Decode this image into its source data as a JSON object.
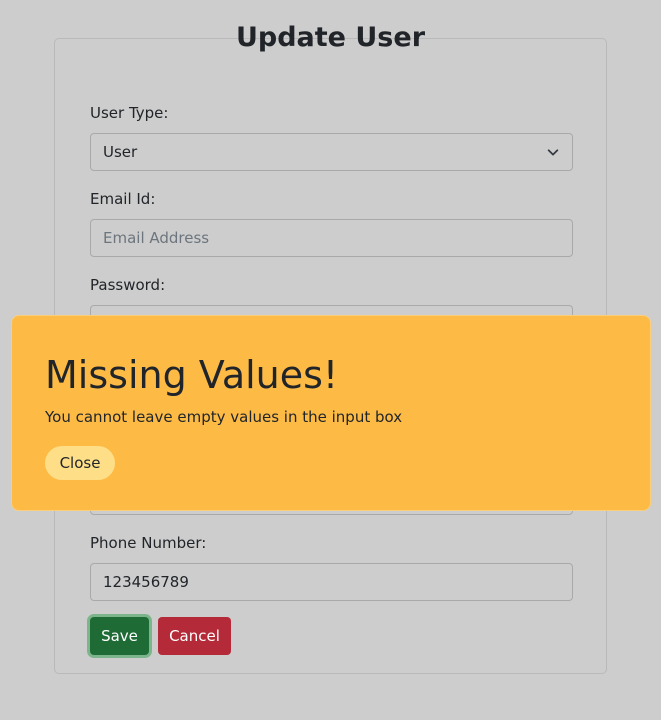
{
  "form": {
    "title": "Update User",
    "user_type_label": "User Type:",
    "user_type_value": "User",
    "email_label": "Email Id:",
    "email_placeholder": "Email Address",
    "email_value": "",
    "password_label": "Password:",
    "phone_label": "Phone Number:",
    "phone_value": "123456789",
    "save_label": "Save",
    "cancel_label": "Cancel"
  },
  "alert": {
    "title": "Missing Values!",
    "message": "You cannot leave empty values in the input box",
    "close_label": "Close"
  },
  "colors": {
    "background": "#cdcdcd",
    "alert": "#fdbb46",
    "save": "#1f6b36",
    "cancel": "#b52a38"
  },
  "icons": {
    "select_arrow": "chevron-down-icon"
  }
}
